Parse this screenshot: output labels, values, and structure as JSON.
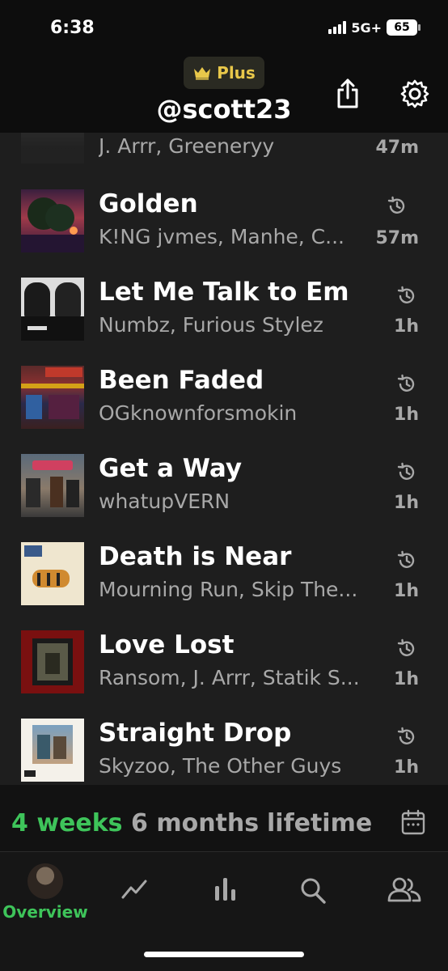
{
  "status_bar": {
    "time": "6:38",
    "network": "5G+",
    "battery": "65"
  },
  "header": {
    "plan_badge": "Plus",
    "username": "@scott23",
    "icons": [
      "share-icon",
      "settings-icon"
    ]
  },
  "tracks": [
    {
      "title": "",
      "artist": "J. Arrr, Greeneryy",
      "time": "47m",
      "history_icon": false
    },
    {
      "title": "Golden",
      "artist": "K!NG jvmes, Manhe, C...",
      "time": "57m",
      "history_icon": true
    },
    {
      "title": "Let Me Talk to Em",
      "artist": "Numbz, Furious Stylez",
      "time": "1h",
      "history_icon": true
    },
    {
      "title": "Been Faded",
      "artist": "OGknownforsmokin",
      "time": "1h",
      "history_icon": true
    },
    {
      "title": "Get a Way",
      "artist": "whatupVERN",
      "time": "1h",
      "history_icon": true
    },
    {
      "title": "Death is Near",
      "artist": "Mourning Run, Skip The...",
      "time": "1h",
      "history_icon": true
    },
    {
      "title": "Love Lost",
      "artist": "Ransom, J. Arrr, Statik S...",
      "time": "1h",
      "history_icon": true
    },
    {
      "title": "Straight Drop",
      "artist": "Skyzoo, The Other Guys",
      "time": "1h",
      "history_icon": true
    }
  ],
  "time_ranges": {
    "items": [
      "4 weeks",
      "6 months",
      "lifetime"
    ],
    "active": "4 weeks"
  },
  "tab_bar": {
    "active_label": "Overview",
    "tabs": [
      "overview",
      "trends-icon",
      "charts-icon",
      "search-icon",
      "friends-icon"
    ]
  },
  "colors": {
    "accent": "#3ec45a",
    "badge": "#e8c74a",
    "background": "#1e1e1e",
    "secondary_text": "#a8a8a8"
  }
}
